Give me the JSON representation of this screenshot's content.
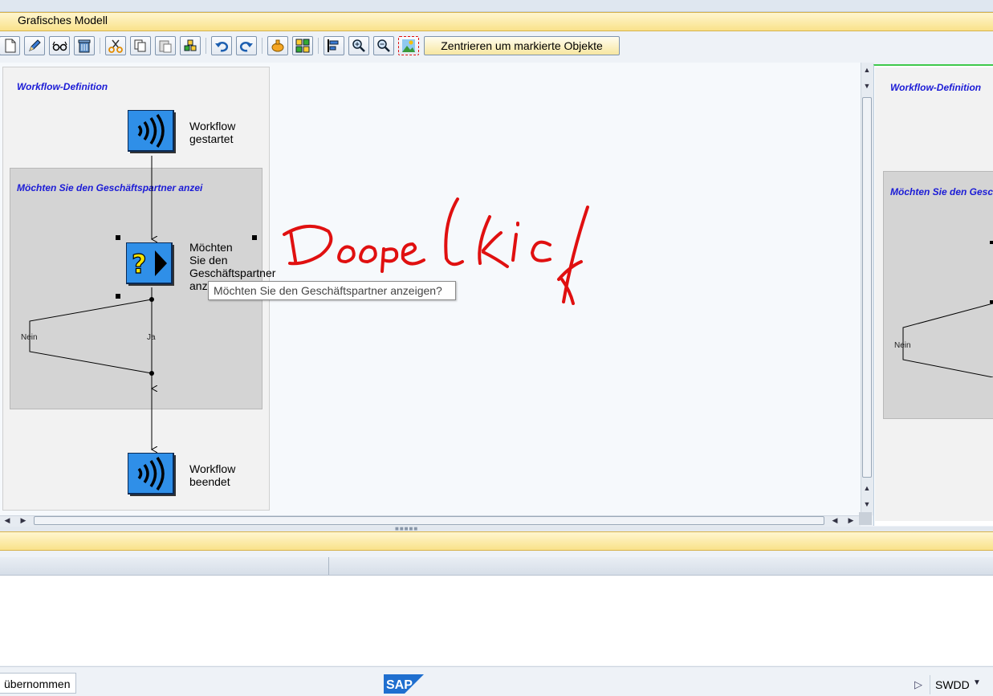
{
  "panel": {
    "title": "Grafisches Modell"
  },
  "toolbar": {
    "center_button_label": "Zentrieren um markierte Objekte",
    "buttons": [
      "new-icon",
      "edit-pencil-icon",
      "glasses-display-icon",
      "delete-trash-icon",
      "cut-icon",
      "copy-icon",
      "paste-icon",
      "insert-block-icon",
      "undo-icon",
      "redo-icon",
      "add-step-icon",
      "structure-icon",
      "align-icon",
      "zoom-in-icon",
      "zoom-out-icon",
      "overview-map-icon"
    ]
  },
  "diagram": {
    "title": "Workflow-Definition",
    "start_label_line1": "Workflow",
    "start_label_line2": "gestartet",
    "decision_title": "Möchten Sie den Geschäftspartner anzei",
    "step_label_line1": "Möchten",
    "step_label_line2": "Sie den",
    "step_label_line3": "Geschäftspartner",
    "step_label_line4": "anz",
    "branch_no": "Nein",
    "branch_yes": "Ja",
    "end_label_line1": "Workflow",
    "end_label_line2": "beendet",
    "tooltip": "Möchten Sie den Geschäftspartner anzeigen?"
  },
  "overview": {
    "title": "Workflow-Definition",
    "decision_title": "Möchten Sie den Gesc",
    "branch_no": "Nein"
  },
  "status": {
    "message": "übernommen",
    "system": "SWDD"
  },
  "colors": {
    "accent_yellow": "#f9e28a",
    "node_blue": "#2f8fe8",
    "title_blue": "#1b1bd6",
    "annotation_red": "#e01010"
  }
}
